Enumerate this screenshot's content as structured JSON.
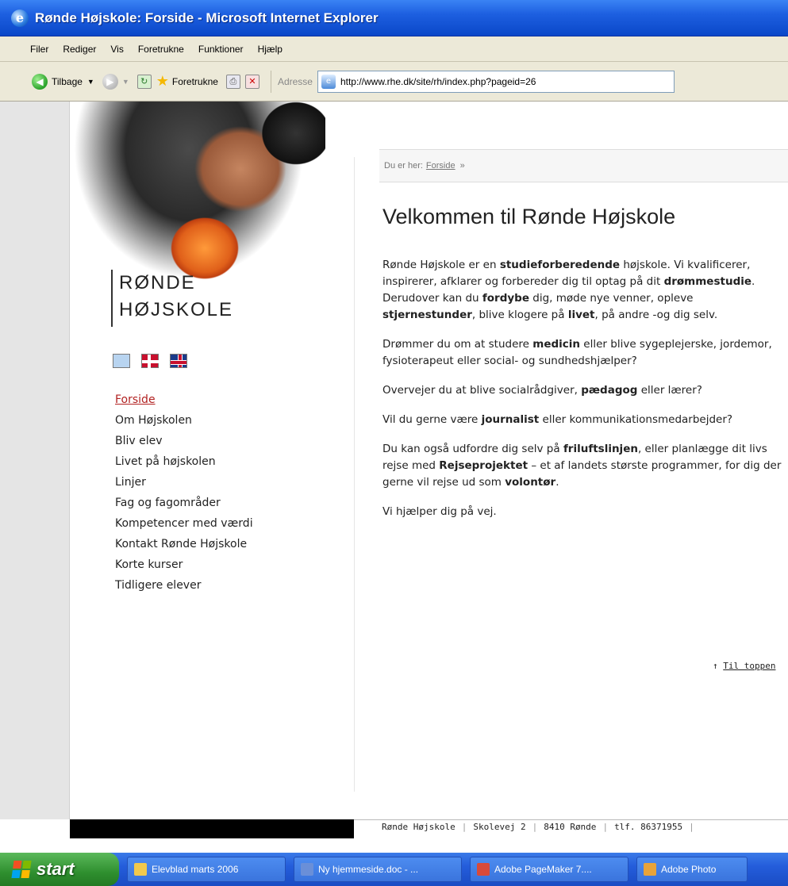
{
  "window": {
    "title": "Rønde Højskole: Forside - Microsoft Internet Explorer"
  },
  "menubar": {
    "items": [
      "Filer",
      "Rediger",
      "Vis",
      "Foretrukne",
      "Funktioner",
      "Hjælp"
    ]
  },
  "toolbar": {
    "back_label": "Tilbage",
    "favorites_label": "Foretrukne",
    "address_label": "Adresse",
    "address_url": "http://www.rhe.dk/site/rh/index.php?pageid=26"
  },
  "site": {
    "logo_line1": "RØNDE",
    "logo_line2": "HØJSKOLE",
    "nav": [
      "Forside",
      "Om Højskolen",
      "Bliv elev",
      "Livet på højskolen",
      "Linjer",
      "Fag og fagområder",
      "Kompetencer med værdi",
      "Kontakt Rønde Højskole",
      "Korte kurser",
      "Tidligere elever"
    ],
    "active_nav": "Forside"
  },
  "breadcrumb": {
    "prefix": "Du er her:",
    "current": "Forside",
    "separator": "»"
  },
  "main": {
    "heading": "Velkommen til Rønde Højskole",
    "paragraphs": {
      "p1_a": "Rønde Højskole er en ",
      "p1_b": "studieforberedende",
      "p1_c": " højskole. Vi kvalificerer, inspirerer, afklarer og forbereder dig til optag på dit ",
      "p1_d": "drømmestudie",
      "p1_e": ". Derudover kan du ",
      "p1_f": "fordybe",
      "p1_g": " dig, møde nye venner, opleve ",
      "p1_h": "stjernestunder",
      "p1_i": ", blive klogere på ",
      "p1_j": "livet",
      "p1_k": ", på andre -og dig selv.",
      "p2_a": "Drømmer du om at studere ",
      "p2_b": "medicin",
      "p2_c": " eller blive sygeplejerske, jordemor, fysioterapeut eller social- og sundhedshjælper?",
      "p3_a": "Overvejer du at blive socialrådgiver, ",
      "p3_b": "pædagog",
      "p3_c": " eller lærer?",
      "p4_a": "Vil du gerne være ",
      "p4_b": "journalist",
      "p4_c": " eller kommunikationsmedarbejder?",
      "p5_a": "Du kan også udfordre dig selv på ",
      "p5_b": "friluftslinjen",
      "p5_c": ", eller planlægge dit livs rejse med ",
      "p5_d": "Rejseprojektet",
      "p5_e": " – et af landets største programmer, for dig der gerne vil rejse ud som ",
      "p5_f": "volontør",
      "p5_g": ".",
      "p6": "Vi hjælper dig på vej."
    },
    "to_top_arrow": "↑",
    "to_top": "Til toppen"
  },
  "footer": {
    "items": [
      "Rønde Højskole",
      "Skolevej 2",
      "8410 Rønde",
      "tlf. 86371955"
    ],
    "separator": "|"
  },
  "taskbar": {
    "start": "start",
    "tasks": [
      {
        "label": "Elevblad marts 2006",
        "icon": "folder-icon",
        "color": "#f2c94c"
      },
      {
        "label": "Ny hjemmeside.doc - ...",
        "icon": "word-icon",
        "color": "#6a8fd8"
      },
      {
        "label": "Adobe PageMaker 7....",
        "icon": "pagemaker-icon",
        "color": "#d84a3a"
      },
      {
        "label": "Adobe Photo",
        "icon": "photoshop-icon",
        "color": "#e8a33a"
      }
    ]
  },
  "colors": {
    "active_nav": "#b22222",
    "titlebar": "#1d5fe0",
    "taskbar": "#245ddb",
    "start_button": "#2f8f2f"
  }
}
